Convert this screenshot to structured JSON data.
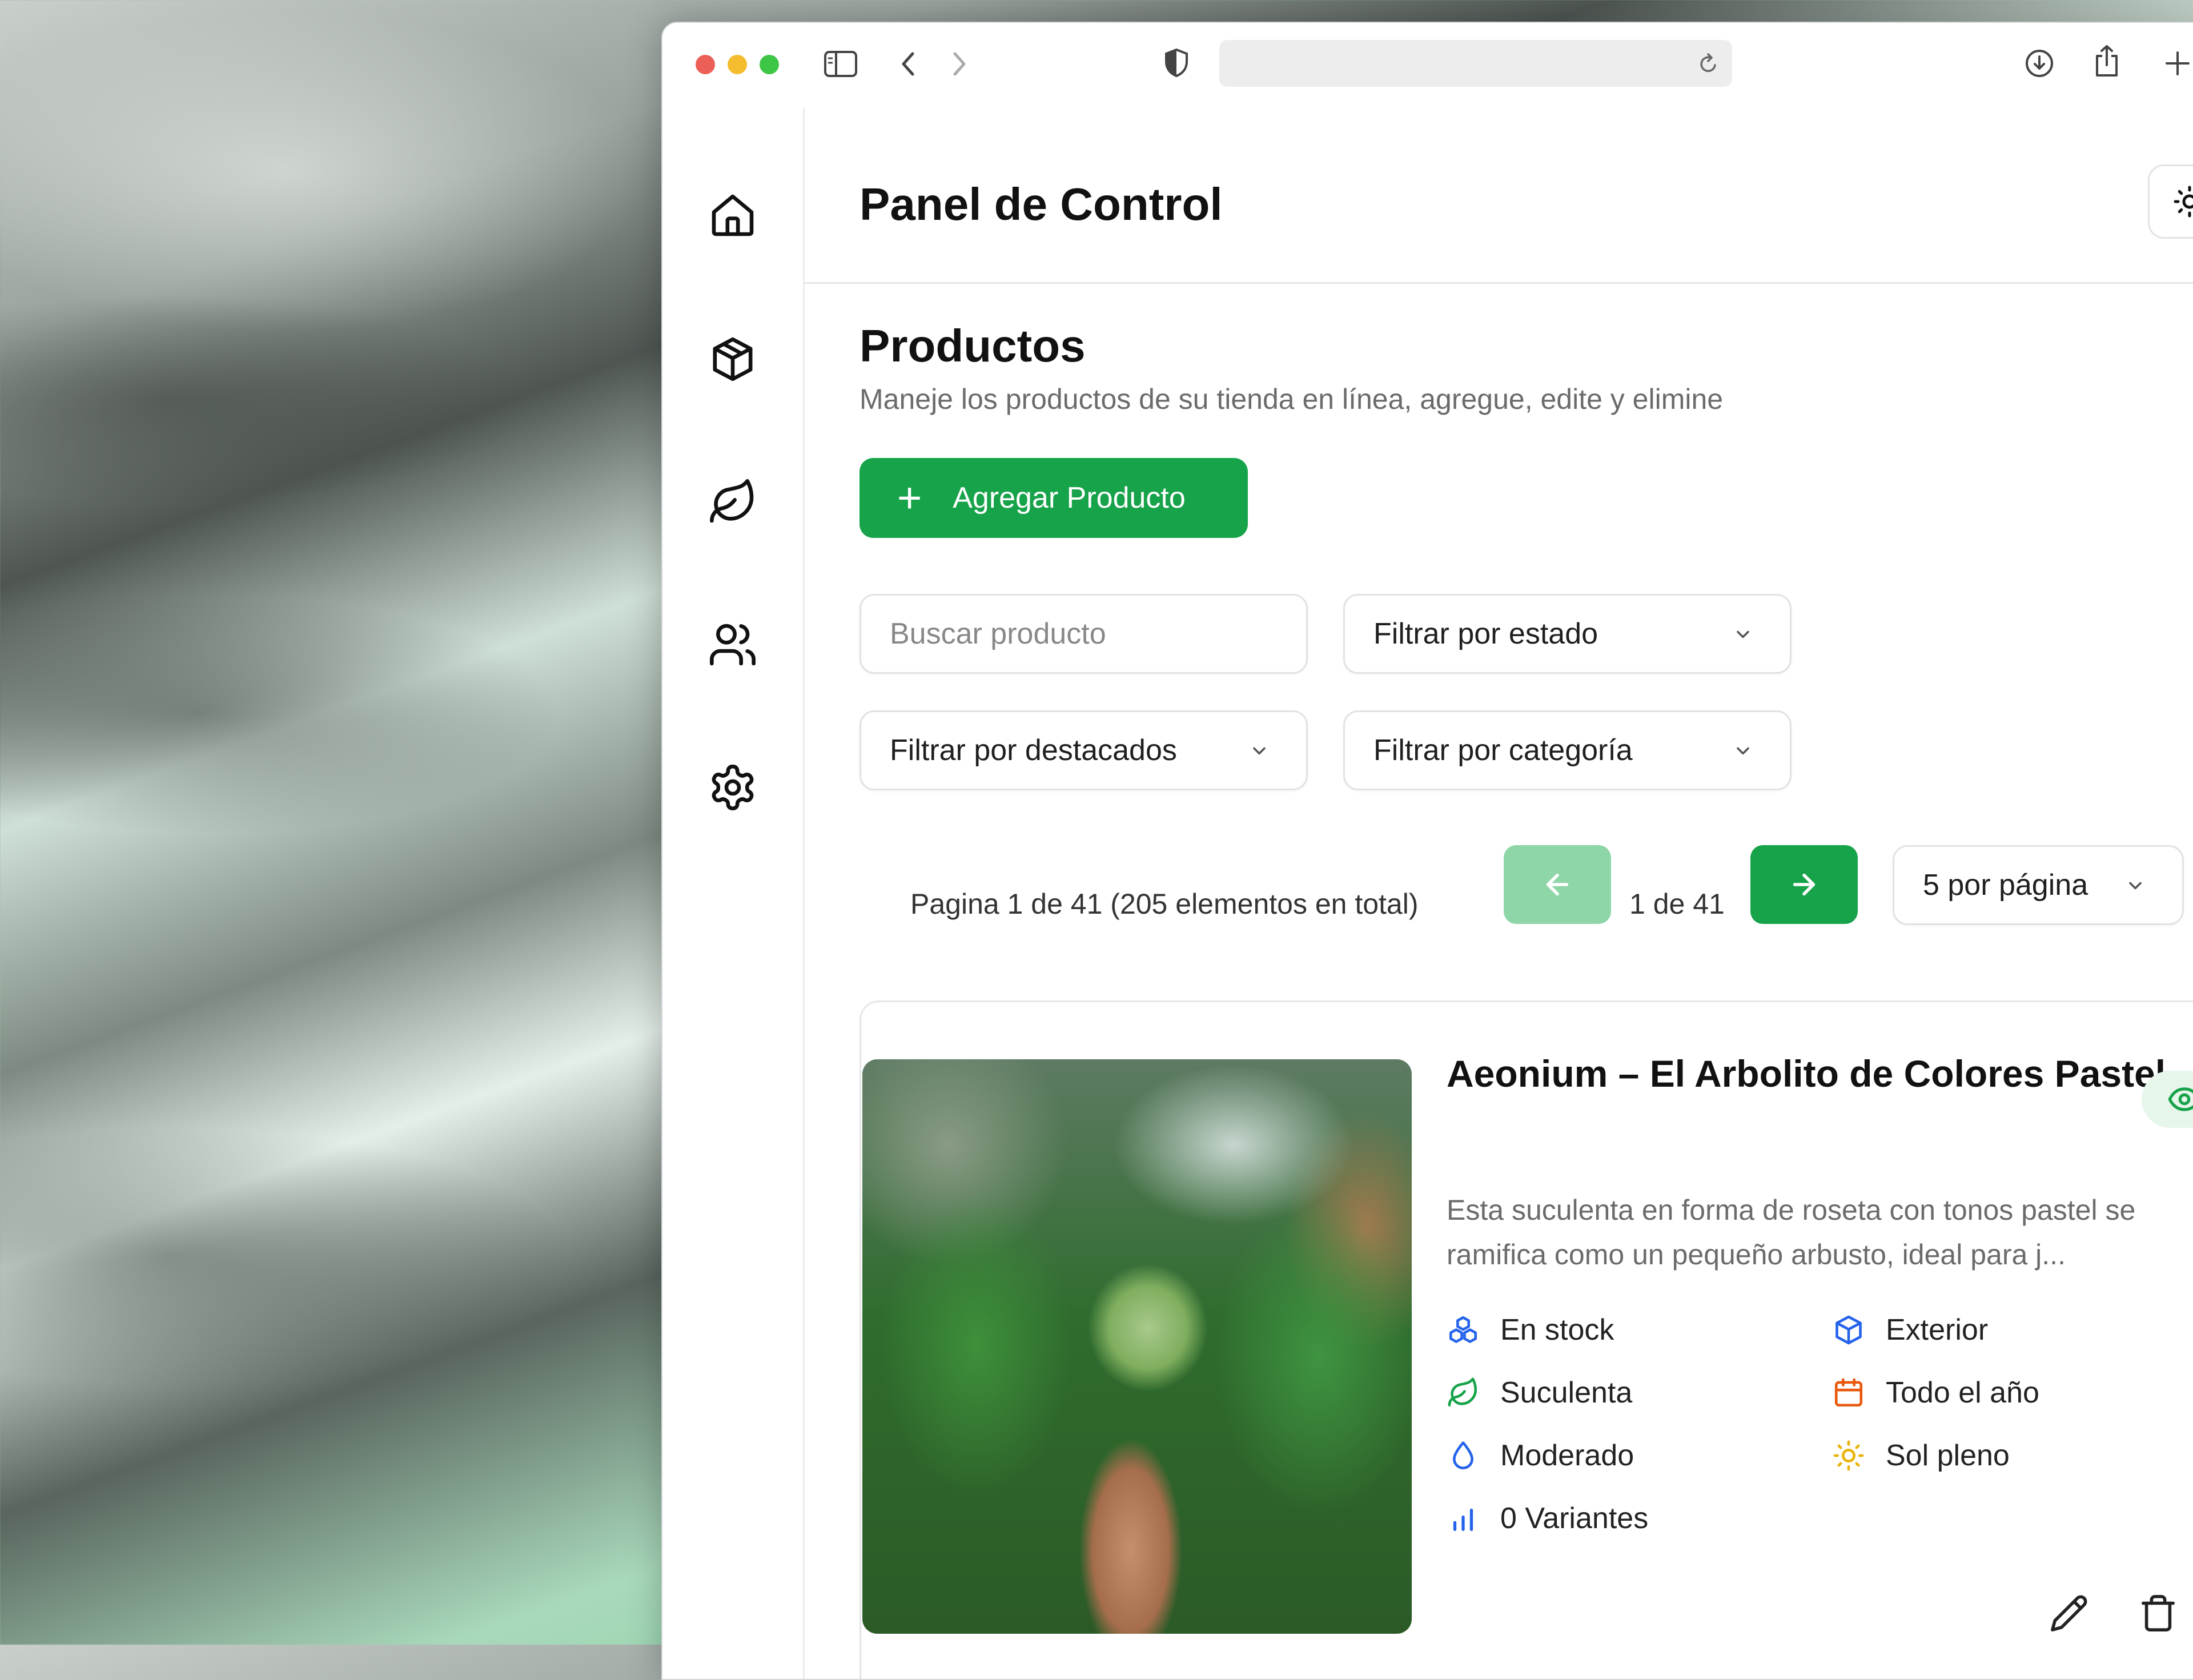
{
  "browser": {
    "address_text": ""
  },
  "header": {
    "title": "Panel de Control"
  },
  "sidebar": {
    "items": [
      {
        "icon": "home-icon"
      },
      {
        "icon": "box-icon"
      },
      {
        "icon": "leaf-icon"
      },
      {
        "icon": "users-icon"
      },
      {
        "icon": "settings-icon"
      }
    ]
  },
  "page": {
    "heading": "Productos",
    "subtitle": "Maneje los productos de su tienda en línea, agregue, edite y elimine",
    "add_button_label": "Agregar Producto"
  },
  "filters": {
    "search_placeholder": "Buscar producto",
    "status_label": "Filtrar por estado",
    "featured_label": "Filtrar por destacados",
    "category_label": "Filtrar por categoría"
  },
  "pagination": {
    "info": "Pagina 1 de 41 (205 elementos en total)",
    "count": "1 de 41",
    "per_page": "5 por página"
  },
  "product": {
    "title": "Aeonium – El Arbolito de Colores Pastel",
    "description": "Esta suculenta en forma de roseta con tonos pastel se ramifica como un pequeño arbusto, ideal para j...",
    "attributes": {
      "stock": "En stock",
      "location": "Exterior",
      "type": "Suculenta",
      "season": "Todo el año",
      "watering": "Moderado",
      "light": "Sol pleno",
      "variants": "0 Variantes"
    }
  },
  "colors": {
    "primary": "#17a34a",
    "primary_disabled": "#8ed6a8",
    "blue_icon": "#2563eb",
    "green_icon": "#16a34a",
    "orange_icon": "#ea580c",
    "yellow_icon": "#eab308"
  }
}
